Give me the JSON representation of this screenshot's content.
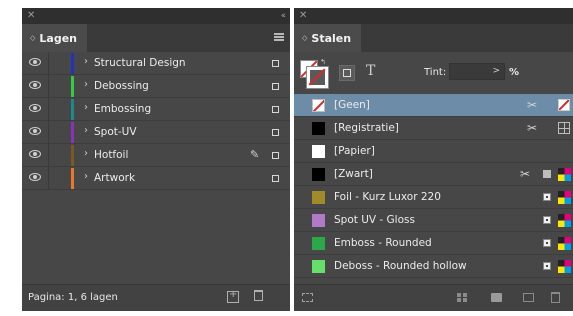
{
  "layers_panel": {
    "title": "Lagen",
    "footer_text": "Pagina: 1, 6 lagen",
    "layers": [
      {
        "name": "Structural Design",
        "color": "#2233bb",
        "visible": true,
        "active_pen": false
      },
      {
        "name": "Debossing",
        "color": "#33cc44",
        "visible": true,
        "active_pen": false
      },
      {
        "name": "Embossing",
        "color": "#1a8a8a",
        "visible": true,
        "active_pen": false
      },
      {
        "name": "Spot-UV",
        "color": "#8833bb",
        "visible": true,
        "active_pen": false
      },
      {
        "name": "Hotfoil",
        "color": "#7a5a22",
        "visible": true,
        "active_pen": true
      },
      {
        "name": "Artwork",
        "color": "#e8782a",
        "visible": true,
        "active_pen": false
      }
    ]
  },
  "swatches_panel": {
    "title": "Stalen",
    "tint_label": "Tint:",
    "tint_value": ">",
    "tint_unit": "%",
    "text_icon_label": "T",
    "swatches": [
      {
        "name": "[Geen]",
        "color": "none",
        "selected": true
      },
      {
        "name": "[Registratie]",
        "color": "#000000",
        "selected": false
      },
      {
        "name": "[Papier]",
        "color": "#ffffff",
        "selected": false
      },
      {
        "name": "[Zwart]",
        "color": "#000000",
        "selected": false
      },
      {
        "name": "Foil - Kurz Luxor 220",
        "color": "#a08a2a",
        "selected": false
      },
      {
        "name": "Spot UV - Gloss",
        "color": "#b07ac8",
        "selected": false
      },
      {
        "name": "Emboss - Rounded",
        "color": "#2aa84a",
        "selected": false
      },
      {
        "name": "Deboss - Rounded hollow",
        "color": "#66e06a",
        "selected": false
      }
    ]
  }
}
